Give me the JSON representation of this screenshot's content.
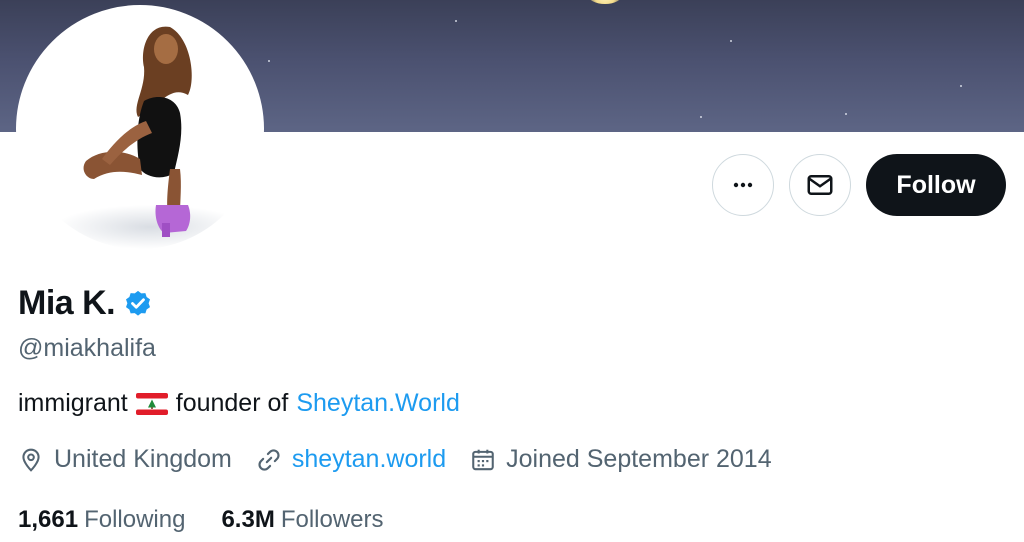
{
  "profile": {
    "display_name": "Mia K.",
    "handle": "@miakhalifa",
    "bio": {
      "prefix": "immigrant",
      "flag_icon": "lebanon-flag",
      "middle": "founder of",
      "link_text": "Sheytan.World"
    },
    "location": "United Kingdom",
    "website": "sheytan.world",
    "joined": "Joined September 2014"
  },
  "actions": {
    "more_icon": "ellipsis-icon",
    "message_icon": "envelope-icon",
    "follow_label": "Follow"
  },
  "stats": {
    "following_count": "1,661",
    "following_label": "Following",
    "followers_count": "6.3M",
    "followers_label": "Followers"
  },
  "colors": {
    "accent": "#1d9bf0",
    "text_primary": "#0f1419",
    "text_secondary": "#536471",
    "verified_badge": "#1d9bf0",
    "follow_button": "#0f1419"
  }
}
